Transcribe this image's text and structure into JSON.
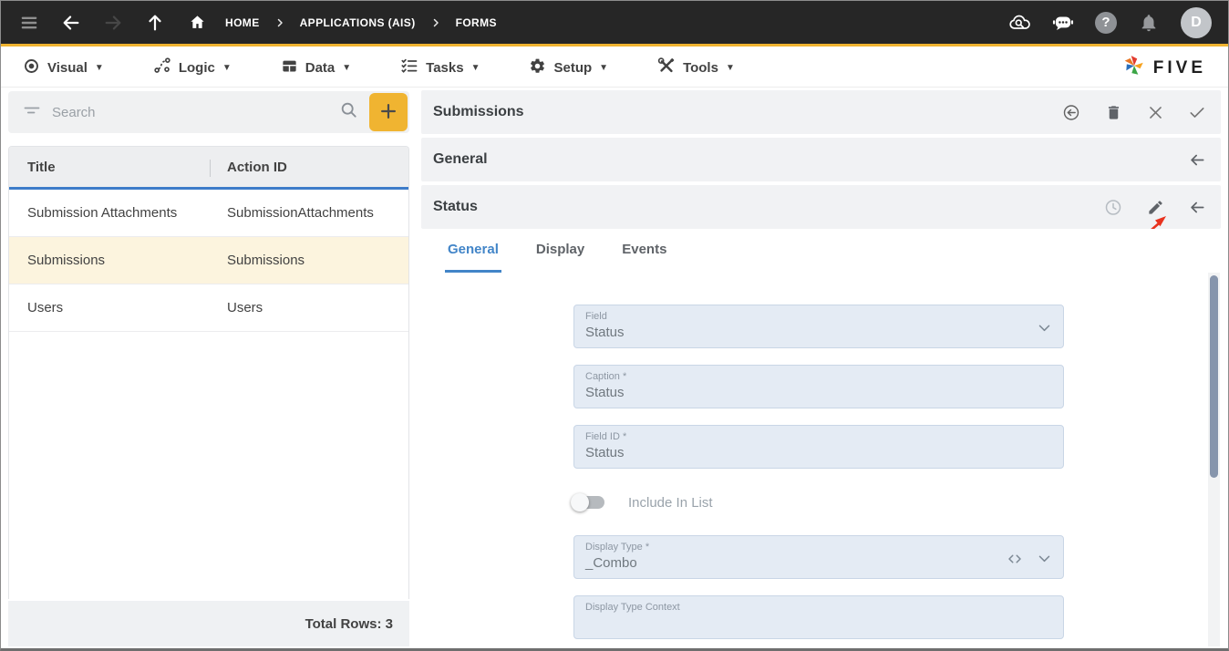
{
  "topbar": {
    "breadcrumb": {
      "home": "HOME",
      "level1": "APPLICATIONS (AIS)",
      "level2": "FORMS"
    },
    "avatar_initial": "D",
    "help_glyph": "?"
  },
  "menubar": {
    "items": [
      {
        "label": "Visual"
      },
      {
        "label": "Logic"
      },
      {
        "label": "Data"
      },
      {
        "label": "Tasks"
      },
      {
        "label": "Setup"
      },
      {
        "label": "Tools"
      }
    ],
    "brand": "FIVE"
  },
  "left_panel": {
    "search": {
      "placeholder": "Search"
    },
    "table": {
      "columns": [
        "Title",
        "Action ID"
      ],
      "rows": [
        {
          "title": "Submission Attachments",
          "action_id": "SubmissionAttachments"
        },
        {
          "title": "Submissions",
          "action_id": "Submissions"
        },
        {
          "title": "Users",
          "action_id": "Users"
        }
      ],
      "selected_row": "Submissions"
    },
    "footer": {
      "total_rows": "Total Rows: 3"
    }
  },
  "right_panel": {
    "title": "Submissions",
    "sections": [
      {
        "label": "General"
      },
      {
        "label": "Status"
      }
    ],
    "tabs": [
      {
        "label": "General",
        "active": true
      },
      {
        "label": "Display",
        "active": false
      },
      {
        "label": "Events",
        "active": false
      }
    ],
    "form": {
      "field": {
        "label": "Field",
        "value": "Status"
      },
      "caption": {
        "label": "Caption *",
        "value": "Status"
      },
      "field_id": {
        "label": "Field ID *",
        "value": "Status"
      },
      "include_in_list": {
        "label": "Include In List",
        "enabled": false
      },
      "display_type": {
        "label": "Display Type *",
        "value": "_Combo"
      },
      "display_type_context": {
        "label": "Display Type Context",
        "value": ""
      }
    }
  },
  "icons": {
    "topbar": [
      "hamburger-icon",
      "back-arrow-icon",
      "forward-arrow-icon",
      "up-arrow-icon",
      "home-icon",
      "cloud-search-icon",
      "chat-bot-icon",
      "help-icon",
      "bell-icon"
    ],
    "menubar": [
      "visual-icon",
      "logic-icon",
      "data-icon",
      "tasks-icon",
      "setup-gear-icon",
      "tools-icon",
      "five-pinwheel-logo"
    ],
    "left_panel": [
      "filter-icon",
      "search-icon",
      "plus-icon"
    ],
    "right_panel": [
      "restore-icon",
      "trash-icon",
      "close-icon",
      "check-icon",
      "collapse-arrow-icon",
      "clock-icon",
      "pencil-icon",
      "chevron-down-icon",
      "code-icon",
      "red-annotation-arrow"
    ]
  },
  "colors": {
    "topbar_bg": "#262626",
    "accent_yellow": "#F0B431",
    "accent_blue": "#4285C8",
    "selected_row_bg": "#FCF4DE",
    "field_bg": "#E4EBF4",
    "annotation_red": "#E8321E"
  }
}
